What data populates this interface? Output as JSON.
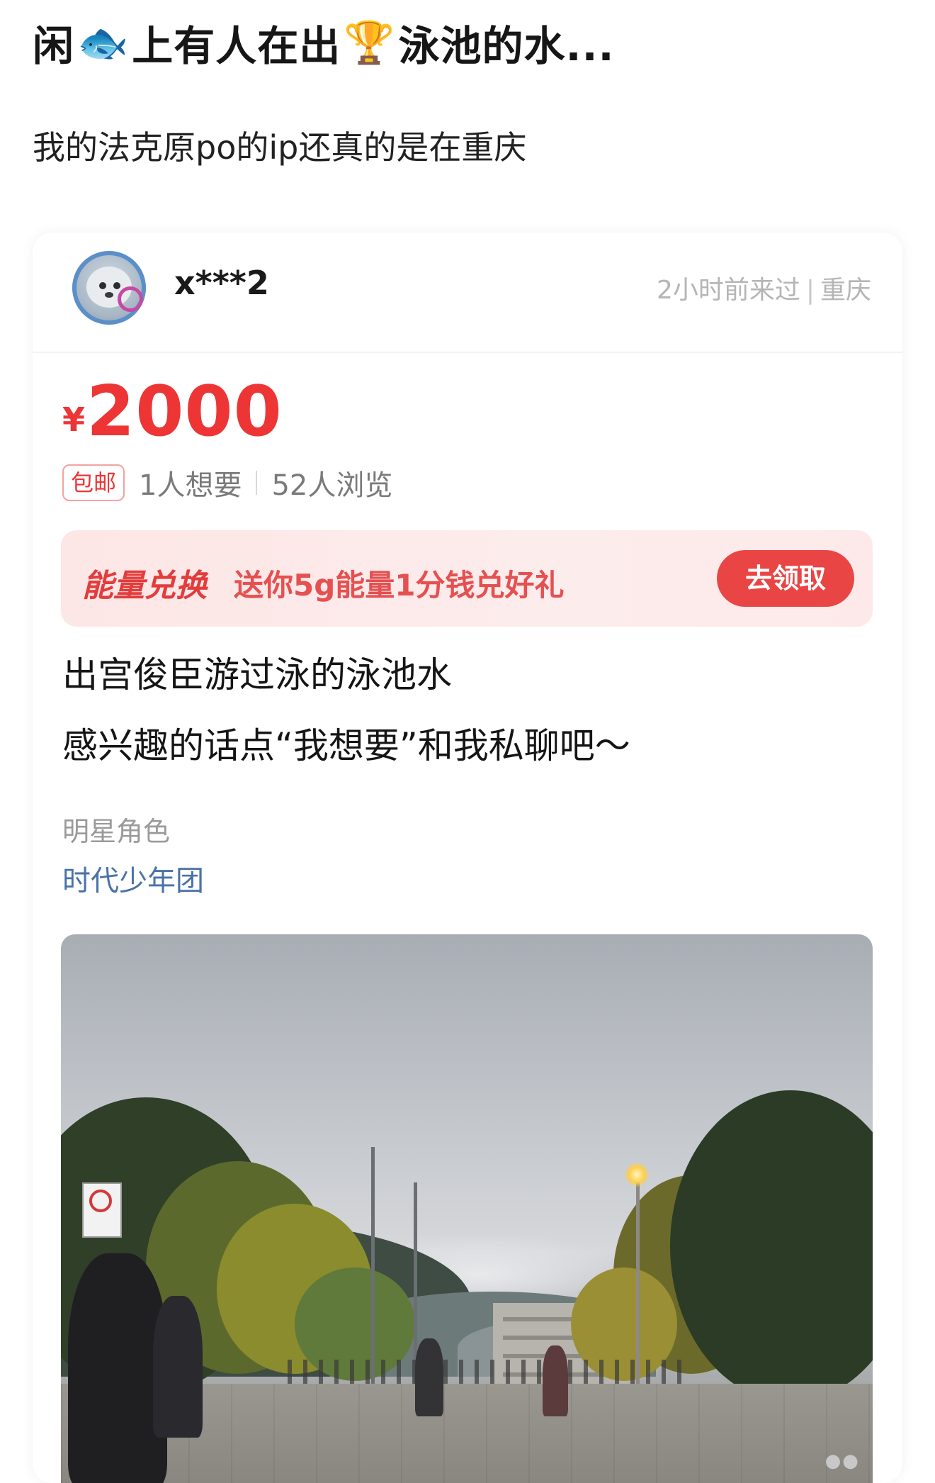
{
  "post": {
    "title_part_1": "闲",
    "title_emoji_1": "🐟",
    "title_part_2": "上有人在出",
    "title_emoji_2": "🏆",
    "title_part_3": "泳池的水...",
    "body": "我的法克原po的ip还真的是在重庆"
  },
  "listing": {
    "seller": {
      "username": "x***2",
      "last_seen": "2小时前来过",
      "location": "重庆"
    },
    "price": {
      "currency": "¥",
      "amount": "2000"
    },
    "badge": "包邮",
    "wants": "1人想要",
    "views": "52人浏览",
    "promo": {
      "title": "能量兑换",
      "text": "送你5g能量1分钱兑好礼",
      "button": "去领取"
    },
    "description": {
      "line1": "出宫俊臣游过泳的泳池水",
      "line2": "感兴趣的话点“我想要”和我私聊吧～"
    },
    "tag": {
      "label": "明星角色",
      "value": "时代少年团"
    }
  },
  "colors": {
    "price_red": "#ee3535",
    "promo_bg": "#fde6e6",
    "tag_blue": "#4a72a8",
    "muted_gray": "#b5b5b5"
  },
  "icons": {
    "fish": "fish-emoji",
    "trophy": "trophy-emoji"
  }
}
